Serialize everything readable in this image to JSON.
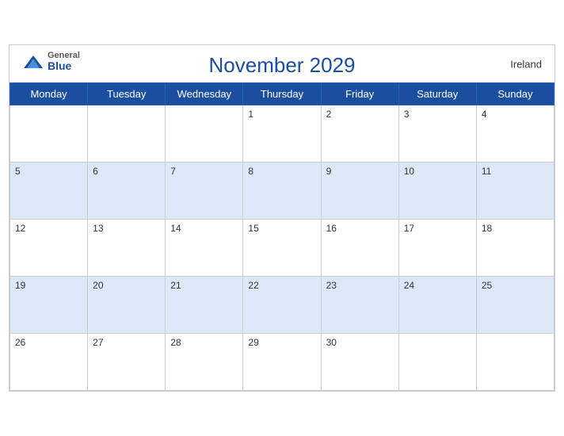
{
  "header": {
    "title": "November 2029",
    "country": "Ireland",
    "logo_general": "General",
    "logo_blue": "Blue"
  },
  "weekdays": [
    "Monday",
    "Tuesday",
    "Wednesday",
    "Thursday",
    "Friday",
    "Saturday",
    "Sunday"
  ],
  "weeks": [
    [
      null,
      null,
      null,
      1,
      2,
      3,
      4
    ],
    [
      5,
      6,
      7,
      8,
      9,
      10,
      11
    ],
    [
      12,
      13,
      14,
      15,
      16,
      17,
      18
    ],
    [
      19,
      20,
      21,
      22,
      23,
      24,
      25
    ],
    [
      26,
      27,
      28,
      29,
      30,
      null,
      null
    ]
  ],
  "row_stripes": [
    false,
    true,
    false,
    true,
    false
  ]
}
